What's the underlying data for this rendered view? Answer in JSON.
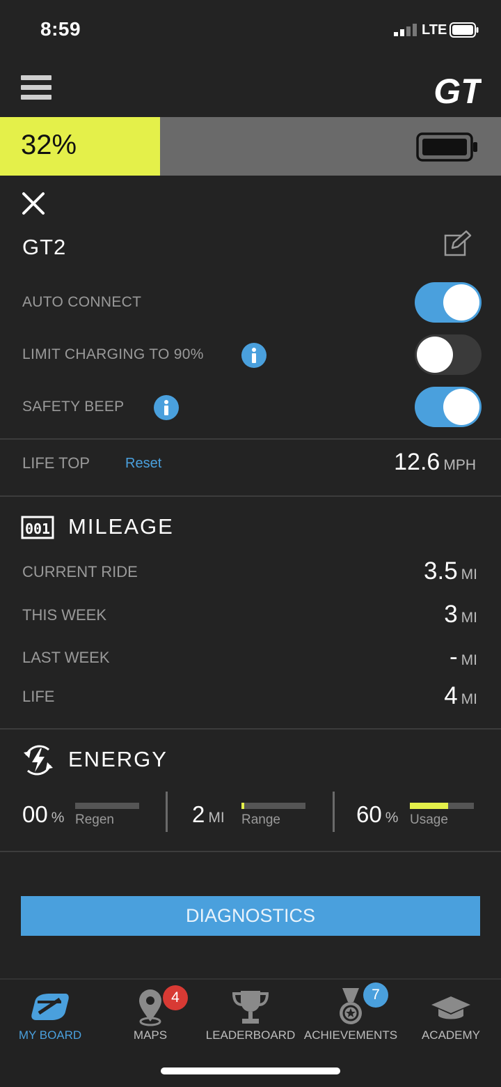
{
  "status_bar": {
    "time": "8:59",
    "network": "LTE",
    "signal_icon": "signal-bars-icon",
    "battery_icon": "phone-battery-icon"
  },
  "header": {
    "menu_icon": "hamburger-menu-icon",
    "logo_text": "GT"
  },
  "battery": {
    "percent_label": "32%",
    "level": 0.32,
    "fill_color": "#e4f04a",
    "track_color": "#6a6a6a"
  },
  "board": {
    "name": "GT2",
    "settings": [
      {
        "label": "AUTO CONNECT",
        "enabled": true,
        "has_info": false
      },
      {
        "label": "LIMIT CHARGING TO 90%",
        "enabled": false,
        "has_info": true
      },
      {
        "label": "SAFETY BEEP",
        "enabled": true,
        "has_info": true
      }
    ],
    "life_top": {
      "label": "LIFE TOP",
      "reset_label": "Reset",
      "value": "12.6",
      "unit": "MPH"
    }
  },
  "mileage": {
    "title": "MILEAGE",
    "icon": "odometer-icon",
    "rows": [
      {
        "label": "CURRENT RIDE",
        "value": "3.5",
        "unit": "MI"
      },
      {
        "label": "THIS WEEK",
        "value": "3",
        "unit": "MI"
      },
      {
        "label": "LAST WEEK",
        "value": "-",
        "unit": "MI"
      },
      {
        "label": "LIFE",
        "value": "4",
        "unit": "MI"
      }
    ]
  },
  "energy": {
    "title": "ENERGY",
    "icon": "energy-bolt-icon",
    "metrics": [
      {
        "value": "00",
        "unit": "%",
        "label": "Regen",
        "level": 0.0
      },
      {
        "value": "2",
        "unit": "MI",
        "label": "Range",
        "level": 0.04
      },
      {
        "value": "60",
        "unit": "%",
        "label": "Usage",
        "level": 0.6
      }
    ]
  },
  "diagnostics_label": "DIAGNOSTICS",
  "accent_color": "#4aa0dd",
  "tabs": [
    {
      "label": "MY BOARD",
      "icon": "board-icon",
      "active": true,
      "badge": ""
    },
    {
      "label": "MAPS",
      "icon": "map-pin-icon",
      "active": false,
      "badge": "4"
    },
    {
      "label": "LEADERBOARD",
      "icon": "trophy-icon",
      "active": false,
      "badge": ""
    },
    {
      "label": "ACHIEVEMENTS",
      "icon": "medal-icon",
      "active": false,
      "badge": "7"
    },
    {
      "label": "ACADEMY",
      "icon": "graduation-cap-icon",
      "active": false,
      "badge": ""
    }
  ]
}
